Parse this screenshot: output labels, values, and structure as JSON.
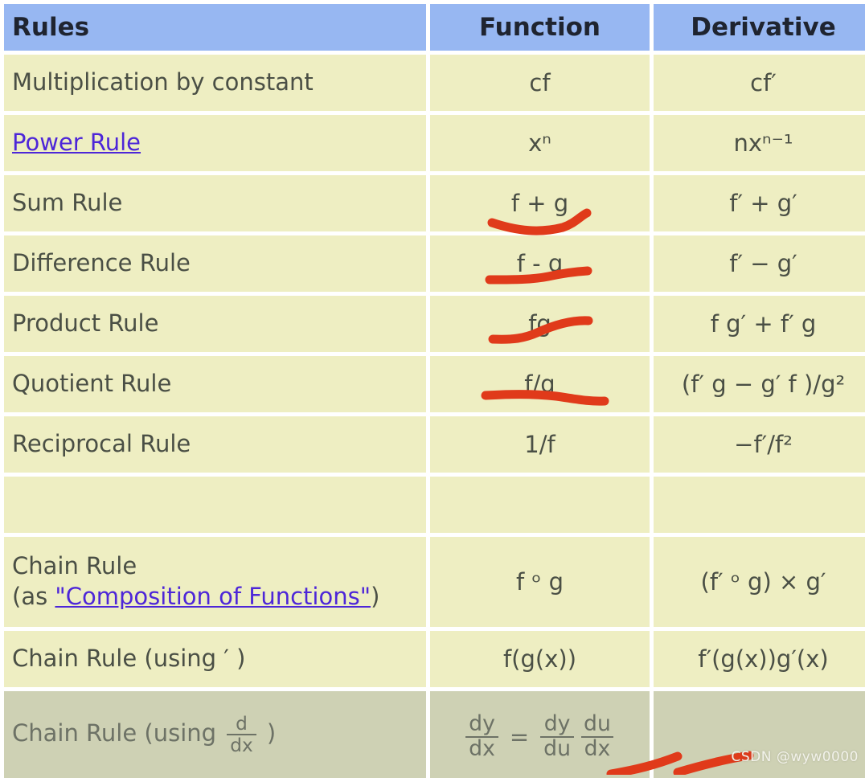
{
  "table": {
    "headers": [
      "Rules",
      "Function",
      "Derivative"
    ],
    "rows": [
      {
        "rule": "Multiplication by constant",
        "rule_link": null,
        "function": "cf",
        "derivative": "cf′",
        "annotated": false,
        "shaded": false,
        "blank": false
      },
      {
        "rule": "Power Rule",
        "rule_link": "Power Rule",
        "function": "xⁿ",
        "derivative": "nxⁿ⁻¹",
        "annotated": false,
        "shaded": false,
        "blank": false
      },
      {
        "rule": "Sum Rule",
        "rule_link": null,
        "function": "f + g",
        "derivative": "f′ + g′",
        "annotated": true,
        "shaded": false,
        "blank": false
      },
      {
        "rule": "Difference Rule",
        "rule_link": null,
        "function": "f - g",
        "derivative": "f′ − g′",
        "annotated": true,
        "shaded": false,
        "blank": false
      },
      {
        "rule": "Product Rule",
        "rule_link": null,
        "function": "fg",
        "derivative": "f g′ + f′ g",
        "annotated": true,
        "shaded": false,
        "blank": false
      },
      {
        "rule": "Quotient Rule",
        "rule_link": null,
        "function": "f/g",
        "derivative": "(f′ g − g′ f )/g²",
        "annotated": true,
        "shaded": false,
        "blank": false
      },
      {
        "rule": "Reciprocal Rule",
        "rule_link": null,
        "function": "1/f",
        "derivative": "−f′/f²",
        "annotated": false,
        "shaded": false,
        "blank": false
      },
      {
        "rule": "",
        "rule_link": null,
        "function": "",
        "derivative": "",
        "annotated": false,
        "shaded": false,
        "blank": true
      },
      {
        "rule": "Chain Rule",
        "rule_link": null,
        "function": "f ᵒ g",
        "derivative": "(f′ ᵒ g) × g′",
        "annotated": false,
        "shaded": false,
        "blank": false
      },
      {
        "rule": "Chain Rule (using ′ )",
        "rule_link": null,
        "function": "f(g(x))",
        "derivative": "f′(g(x))g′(x)",
        "annotated": false,
        "shaded": false,
        "blank": false
      },
      {
        "rule": "Chain Rule (using ",
        "rule_link": null,
        "function": "",
        "derivative": "",
        "annotated": true,
        "shaded": true,
        "blank": false
      }
    ]
  },
  "chain_rule_row": {
    "label_prefix": "Chain Rule (using ",
    "label_suffix": " )",
    "label_fraction": {
      "numerator": "d",
      "denominator": "dx"
    },
    "function_equation": {
      "left": {
        "numerator": "dy",
        "denominator": "dx"
      },
      "operator": "=",
      "right_1": {
        "numerator": "dy",
        "denominator": "du"
      },
      "right_2": {
        "numerator": "du",
        "denominator": "dx"
      }
    }
  },
  "composition_row": {
    "line1": "Chain Rule",
    "prefix": "(as ",
    "link": "\"Composition of Functions\"",
    "suffix": ")"
  },
  "watermark": {
    "text": "CSDN @wyw0000"
  },
  "colors": {
    "header_blue": "#97b7f2",
    "body_yellow": "#eeeec2",
    "shaded_row": "#ced1b4",
    "annotation_red": "#e03a1a",
    "link_purple": "#4d26d8",
    "text_gray": "#4a4f45"
  }
}
